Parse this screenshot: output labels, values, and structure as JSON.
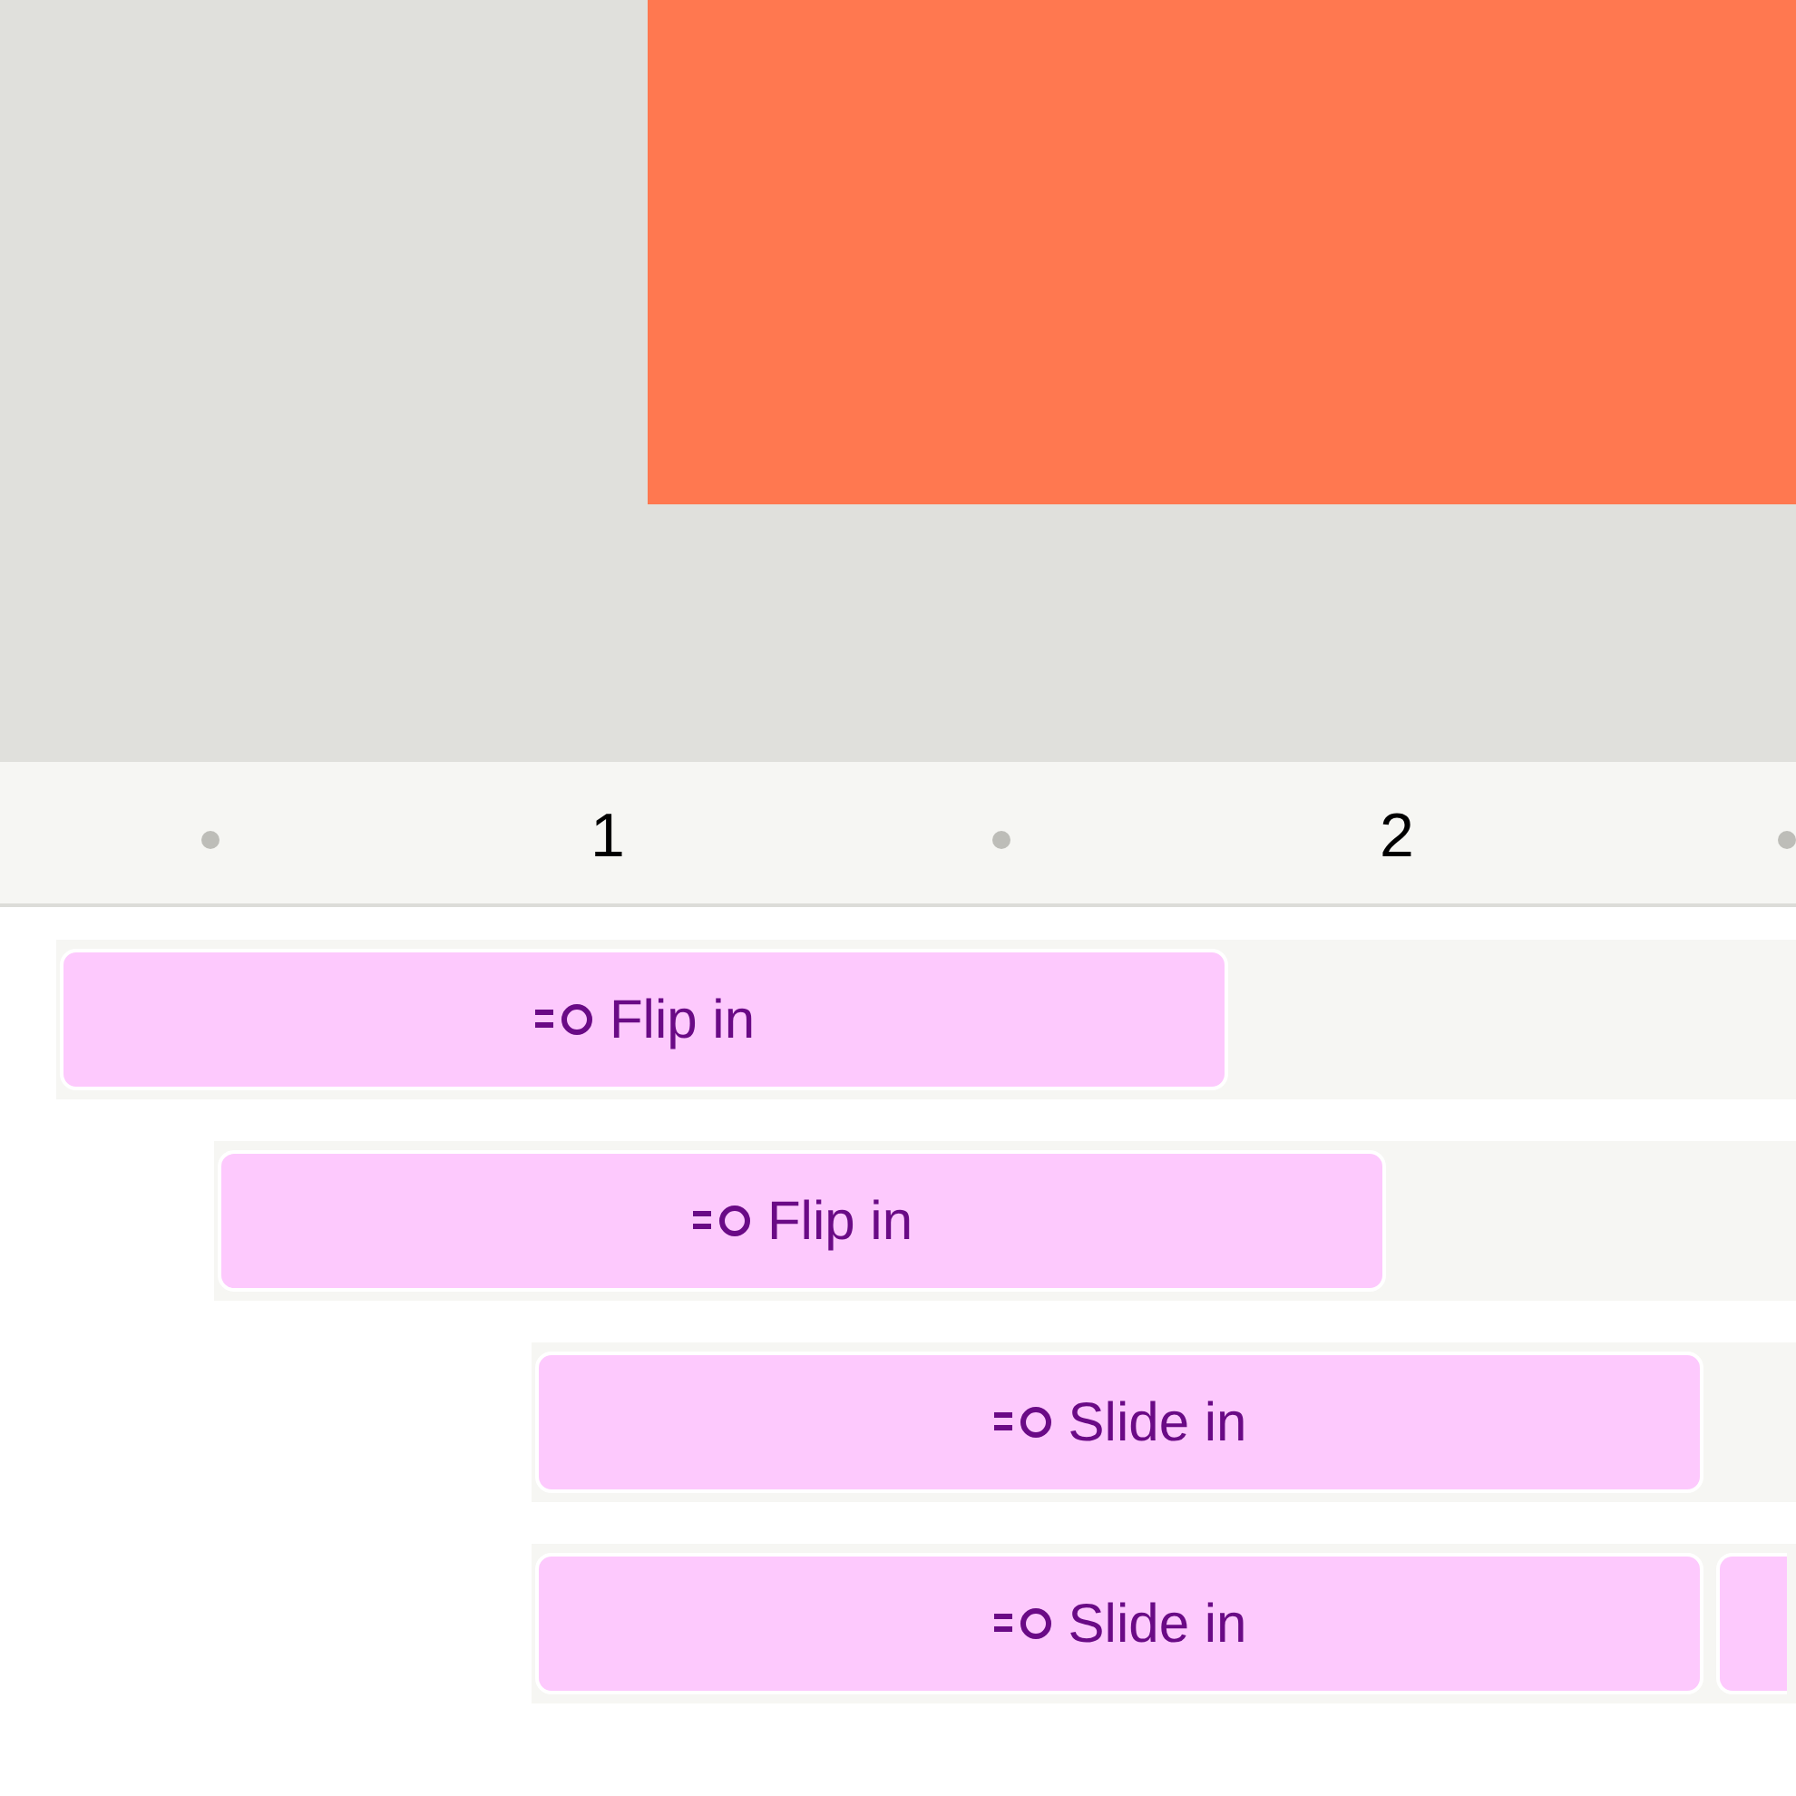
{
  "ruler": {
    "labels": [
      "1",
      "2"
    ]
  },
  "tracks": [
    {
      "label": "Flip in"
    },
    {
      "label": "Flip in"
    },
    {
      "label": "Slide in"
    },
    {
      "label": "Slide in"
    }
  ]
}
